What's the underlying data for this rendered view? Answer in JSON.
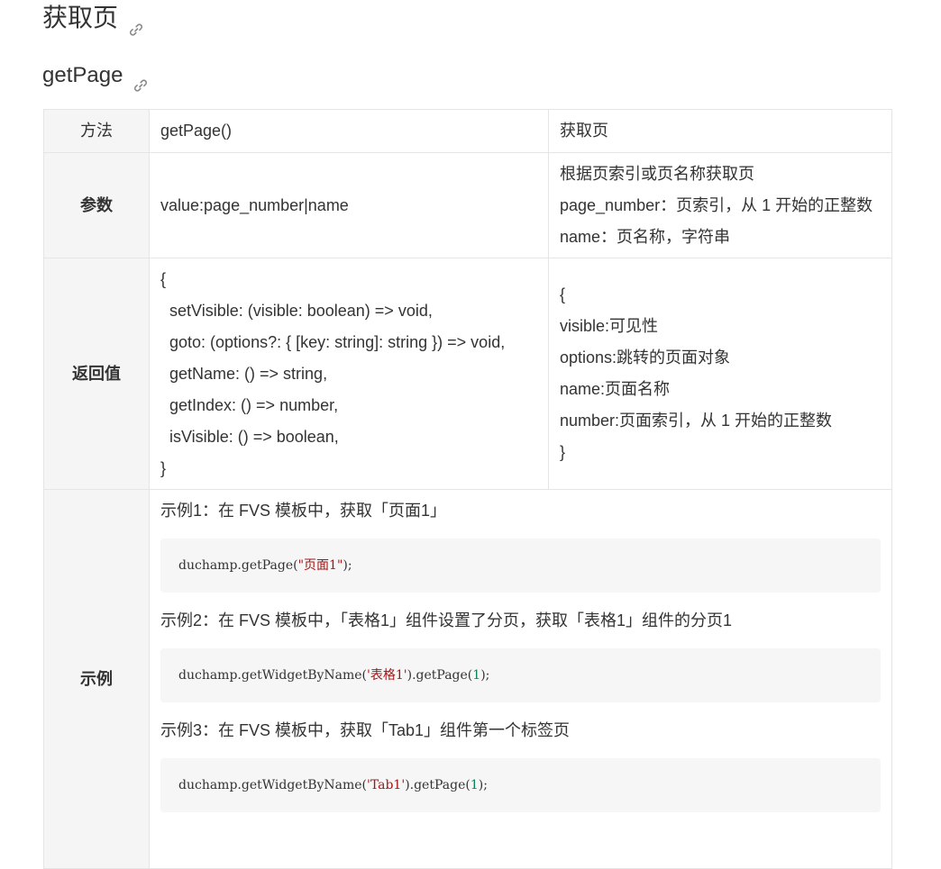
{
  "heading": "获取页",
  "subheading": "getPage",
  "icons": {
    "anchor": "link-icon"
  },
  "table": {
    "method": {
      "label": "方法",
      "signature": "getPage()",
      "desc": "获取页"
    },
    "params": {
      "label": "参数",
      "value": "value:page_number|name",
      "desc": [
        "根据页索引或页名称获取页",
        "page_number：页索引，从 1 开始的正整数",
        "name：页名称，字符串"
      ]
    },
    "returns": {
      "label": "返回值",
      "code": [
        "{",
        "  setVisible: (visible: boolean) => void,",
        "  goto: (options?: { [key: string]: string }) => void,",
        "  getName: () => string,",
        "  getIndex: () => number,",
        "  isVisible: () => boolean,",
        "}"
      ],
      "desc": [
        "{",
        "visible:可见性",
        "options:跳转的页面对象",
        "name:页面名称",
        "number:页面索引，从 1 开始的正整数",
        "}"
      ]
    },
    "examples": {
      "label": "示例",
      "items": [
        {
          "title": "示例1：在 FVS 模板中，获取「页面1」",
          "code_pre": "duchamp.getPage(",
          "code_str": "\"页面1\"",
          "code_num": "",
          "code_post": ");"
        },
        {
          "title": "示例2：在 FVS 模板中，「表格1」组件设置了分页，获取「表格1」组件的分页1",
          "code_pre": "duchamp.getWidgetByName(",
          "code_str": "'表格1'",
          "code_mid": ").getPage(",
          "code_num": "1",
          "code_post": ");"
        },
        {
          "title": "示例3：在 FVS 模板中，获取「Tab1」组件第一个标签页",
          "code_pre": "duchamp.getWidgetByName(",
          "code_str": "'Tab1'",
          "code_mid": ").getPage(",
          "code_num": "1",
          "code_post": ");"
        }
      ]
    }
  }
}
